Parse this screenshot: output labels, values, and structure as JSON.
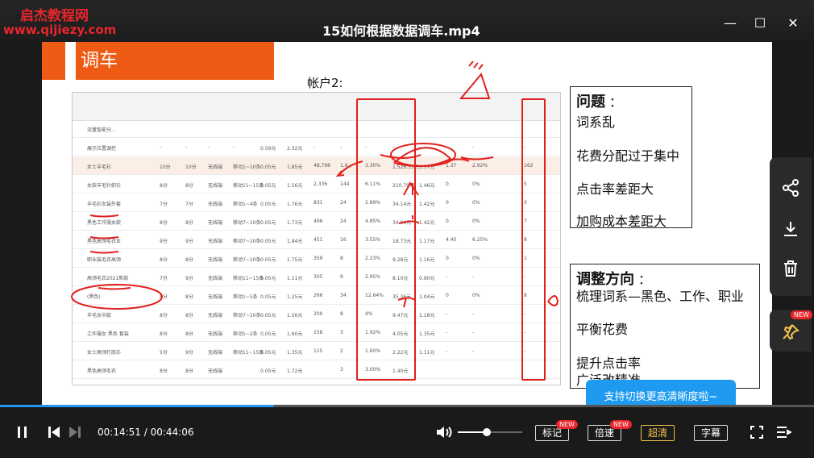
{
  "watermark": {
    "line1": "启杰教程网",
    "line2": "www.qijiezy.com"
  },
  "video_title": "15如何根据数据调车.mp4",
  "window_controls": {
    "minimize": "—",
    "maximize": "☐",
    "close": "✕"
  },
  "slide": {
    "title": "调车",
    "account_label": "帐户2:",
    "table": {
      "rows": [
        {
          "name": "流量智能分...",
          "bid": "",
          "bid2": "",
          "match": "",
          "pos": "",
          "ppc": "",
          "cost": "",
          "imp": "",
          "click": "",
          "ctr": "",
          "spend": "",
          "cpc": "",
          "cart": "",
          "cartcost": "",
          "rank": ""
        },
        {
          "name": "展示位置调控",
          "bid": "-",
          "bid2": "-",
          "match": "-",
          "pos": "-",
          "ppc": "0.59元",
          "cost": "2.32元",
          "imp": "-",
          "click": "-",
          "ctr": "-",
          "spend": "-",
          "cpc": "-",
          "cart": "-",
          "cartcost": "-",
          "rank": "-"
        },
        {
          "name": "女士羊毛衫",
          "bid": "10分",
          "bid2": "10分",
          "match": "无线端",
          "pos": "移动1~10条",
          "ppc": "0.05元",
          "cost": "1.85元",
          "imp": "48,798",
          "click": "1,6..",
          "ctr": "3.30%",
          "spend": "1,526.53元",
          "cpc": "1.57元",
          "cart": "1.37",
          "cartcost": "2.92%",
          "rank": "162"
        },
        {
          "name": "女款羊毛针织衫",
          "bid": "8分",
          "bid2": "8分",
          "match": "无线端",
          "pos": "移动11~15条",
          "ppc": "0.05元",
          "cost": "1.56元",
          "imp": "2,336",
          "click": "144",
          "ctr": "6.11%",
          "spend": "210.70元",
          "cpc": "1.46元",
          "cart": "0",
          "cartcost": "0%",
          "rank": "5"
        },
        {
          "name": "羊毛衫女装外套",
          "bid": "7分",
          "bid2": "7分",
          "match": "无线端",
          "pos": "移动1~4条",
          "ppc": "0.05元",
          "cost": "1.76元",
          "imp": "831",
          "click": "24",
          "ctr": "2.89%",
          "spend": "34.14元",
          "cpc": "1.42元",
          "cart": "0",
          "cartcost": "0%",
          "rank": "0"
        },
        {
          "name": "黑色工作服女款",
          "bid": "8分",
          "bid2": "8分",
          "match": "无线端",
          "pos": "移动7~10条",
          "ppc": "0.05元",
          "cost": "1.73元",
          "imp": "496",
          "click": "24",
          "ctr": "4.85%",
          "spend": "34.04元",
          "cpc": "1.42元",
          "cart": "0",
          "cartcost": "0%",
          "rank": "7"
        },
        {
          "name": "黑色高领毛衣女",
          "bid": "9分",
          "bid2": "9分",
          "match": "无线端",
          "pos": "移动7~10条",
          "ppc": "0.05元",
          "cost": "1.84元",
          "imp": "451",
          "click": "16",
          "ctr": "3.55%",
          "spend": "18.73元",
          "cpc": "1.17元",
          "cart": "4.40",
          "cartcost": "6.25%",
          "rank": "8"
        },
        {
          "name": "职业装毛衣高领",
          "bid": "8分",
          "bid2": "8分",
          "match": "无线端",
          "pos": "移动7~10条",
          "ppc": "0.05元",
          "cost": "1.75元",
          "imp": "359",
          "click": "8",
          "ctr": "2.23%",
          "spend": "9.28元",
          "cpc": "1.16元",
          "cart": "0",
          "cartcost": "0%",
          "rank": "1"
        },
        {
          "name": "高领毛衣2021新款",
          "bid": "7分",
          "bid2": "9分",
          "match": "无线端",
          "pos": "移动11~15条",
          "ppc": "0.05元",
          "cost": "1.11元",
          "imp": "305",
          "click": "9",
          "ctr": "2.95%",
          "spend": "8.10元",
          "cpc": "0.90元",
          "cart": "-",
          "cartcost": "-",
          "rank": "-"
        },
        {
          "name": "(黑色)",
          "bid": "8分",
          "bid2": "8分",
          "match": "无线端",
          "pos": "移动1~5条",
          "ppc": "0.05元",
          "cost": "1.25元",
          "imp": "266",
          "click": "34",
          "ctr": "12.64%",
          "spend": "35.36元",
          "cpc": "1.04元",
          "cart": "0",
          "cartcost": "0%",
          "rank": "8"
        },
        {
          "name": "羊毛女中款",
          "bid": "8分",
          "bid2": "8分",
          "match": "无线端",
          "pos": "移动7~10条",
          "ppc": "0.05元",
          "cost": "1.56元",
          "imp": "200",
          "click": "8",
          "ctr": "4%",
          "spend": "9.47元",
          "cpc": "1.18元",
          "cart": "-",
          "cartcost": "-",
          "rank": "-"
        },
        {
          "name": "工作服女 黑色 套装",
          "bid": "8分",
          "bid2": "8分",
          "match": "无线端",
          "pos": "移动1~2条",
          "ppc": "0.05元",
          "cost": "1.60元",
          "imp": "158",
          "click": "3",
          "ctr": "1.92%",
          "spend": "4.05元",
          "cpc": "1.35元",
          "cart": "-",
          "cartcost": "-",
          "rank": "-"
        },
        {
          "name": "女士高领打底衫",
          "bid": "5分",
          "bid2": "9分",
          "match": "无线端",
          "pos": "移动11~15条",
          "ppc": "0.05元",
          "cost": "1.35元",
          "imp": "115",
          "click": "2",
          "ctr": "1.60%",
          "spend": "2.22元",
          "cpc": "1.11元",
          "cart": "-",
          "cartcost": "-",
          "rank": "-"
        },
        {
          "name": "黑色高领毛衣",
          "bid": "8分",
          "bid2": "8分",
          "match": "无线端",
          "pos": "",
          "ppc": "0.05元",
          "cost": "1.72元",
          "imp": "",
          "click": "3",
          "ctr": "3.00%",
          "spend": "1.40元",
          "cpc": "",
          "cart": "",
          "cartcost": "",
          "rank": ""
        }
      ]
    },
    "problems": {
      "heading": "问题",
      "colon": "：",
      "items": [
        "词系乱",
        "花费分配过于集中",
        "点击率差距大",
        "加购成本差距大"
      ]
    },
    "adjust": {
      "heading": "调整方向",
      "colon": "：",
      "items": [
        "梳理词系—黑色、工作、职业",
        "平衡花费",
        "提升点击率",
        "广泛改精准"
      ]
    }
  },
  "player": {
    "progress_fraction": 0.337,
    "time_current": "00:14:51",
    "time_sep": " / ",
    "time_total": "00:44:06",
    "btn_mark": "标记",
    "btn_speed": "倍速",
    "btn_quality": "超清",
    "btn_subtitle": "字幕",
    "new_badge": "NEW",
    "tooltip": "支持切换更高清晰度啦~",
    "volume_fraction": 0.45
  },
  "colors": {
    "accent": "#1e9bf0",
    "slide_orange": "#ee5b14",
    "quality_gold": "#f0c24b",
    "annot_red": "#e0201c"
  }
}
